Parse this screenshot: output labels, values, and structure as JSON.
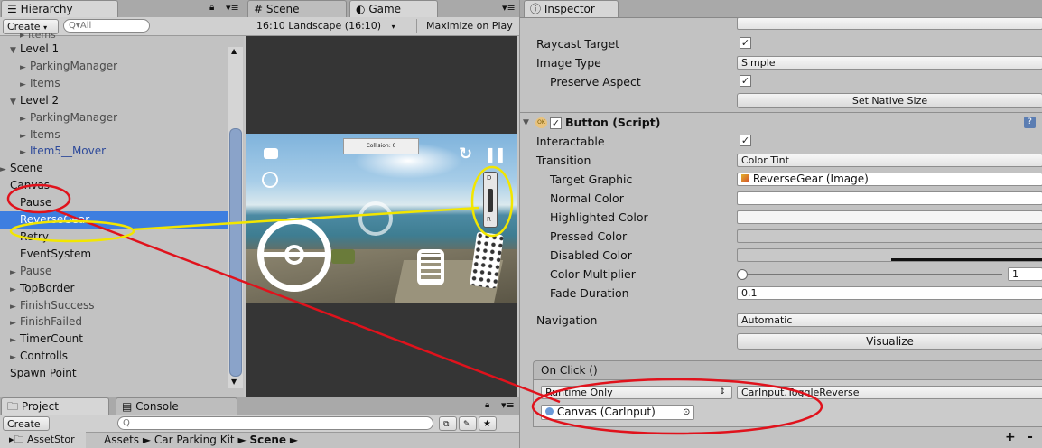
{
  "hierarchy": {
    "tab": "Hierarchy",
    "create_label": "Create",
    "search_placeholder": "Q▾All",
    "rows": [
      {
        "label": "Level 1",
        "indent": 1,
        "arrow": "▼",
        "style": ""
      },
      {
        "label": "ParkingManager",
        "indent": 2,
        "arrow": "►",
        "style": "prefab"
      },
      {
        "label": "Items",
        "indent": 2,
        "arrow": "►",
        "style": "prefab"
      },
      {
        "label": "Level 2",
        "indent": 1,
        "arrow": "▼",
        "style": ""
      },
      {
        "label": "ParkingManager",
        "indent": 2,
        "arrow": "►",
        "style": "prefab"
      },
      {
        "label": "Items",
        "indent": 2,
        "arrow": "►",
        "style": "prefab"
      },
      {
        "label": "Item5__Mover",
        "indent": 2,
        "arrow": "►",
        "style": "blue"
      },
      {
        "label": "Scene",
        "indent": 0,
        "arrow": "►",
        "style": ""
      },
      {
        "label": "Canvas",
        "indent": 0,
        "arrow": "",
        "style": ""
      },
      {
        "label": "Pause",
        "indent": 1,
        "arrow": "",
        "style": ""
      },
      {
        "label": "ReverseGear",
        "indent": 1,
        "arrow": "",
        "style": "sel"
      },
      {
        "label": "Retry",
        "indent": 1,
        "arrow": "",
        "style": ""
      },
      {
        "label": "EventSystem",
        "indent": 1,
        "arrow": "",
        "style": ""
      },
      {
        "label": "Pause",
        "indent": 1,
        "arrow": "►",
        "style": "prefab"
      },
      {
        "label": "TopBorder",
        "indent": 1,
        "arrow": "►",
        "style": ""
      },
      {
        "label": "FinishSuccess",
        "indent": 1,
        "arrow": "►",
        "style": "prefab"
      },
      {
        "label": "FinishFailed",
        "indent": 1,
        "arrow": "►",
        "style": "prefab"
      },
      {
        "label": "TimerCount",
        "indent": 1,
        "arrow": "►",
        "style": ""
      },
      {
        "label": "Controlls",
        "indent": 1,
        "arrow": "►",
        "style": ""
      },
      {
        "label": "Spawn Point",
        "indent": 0,
        "arrow": "",
        "style": ""
      }
    ]
  },
  "project": {
    "tab": "Project",
    "console_tab": "Console",
    "create_label": "Create",
    "breadcrumb": [
      "Assets",
      "Car Parking Kit",
      "Scene"
    ],
    "left_item": "AssetStor"
  },
  "game": {
    "scene_tab": "Scene",
    "game_tab": "Game",
    "aspect": "16:10 Landscape (16:10)",
    "maximize": "Maximize on Play",
    "collision": "Collision: 0",
    "gear_d": "D",
    "gear_r": "R"
  },
  "inspector": {
    "tab": "Inspector",
    "raycast_target": "Raycast Target",
    "image_type": "Image Type",
    "image_type_value": "Simple",
    "preserve_aspect": "Preserve Aspect",
    "set_native_size": "Set Native Size",
    "component": "Button (Script)",
    "interactable": "Interactable",
    "transition": "Transition",
    "transition_value": "Color Tint",
    "target_graphic": "Target Graphic",
    "target_graphic_value": "ReverseGear (Image)",
    "normal_color": "Normal Color",
    "highlighted_color": "Highlighted Color",
    "pressed_color": "Pressed Color",
    "disabled_color": "Disabled Color",
    "color_multiplier": "Color Multiplier",
    "color_multiplier_value": "1",
    "fade_duration": "Fade Duration",
    "fade_duration_value": "0.1",
    "navigation": "Navigation",
    "navigation_value": "Automatic",
    "visualize": "Visualize",
    "onclick": "On Click ()",
    "runtime": "Runtime Only",
    "function": "CarInput.ToggleReverse",
    "object": "Canvas (CarInput)",
    "plus": "+",
    "minus": "-"
  },
  "colors": {
    "selection": "#3d7ee0",
    "annotation_red": "#e0121c",
    "annotation_yellow": "#f2e600"
  }
}
